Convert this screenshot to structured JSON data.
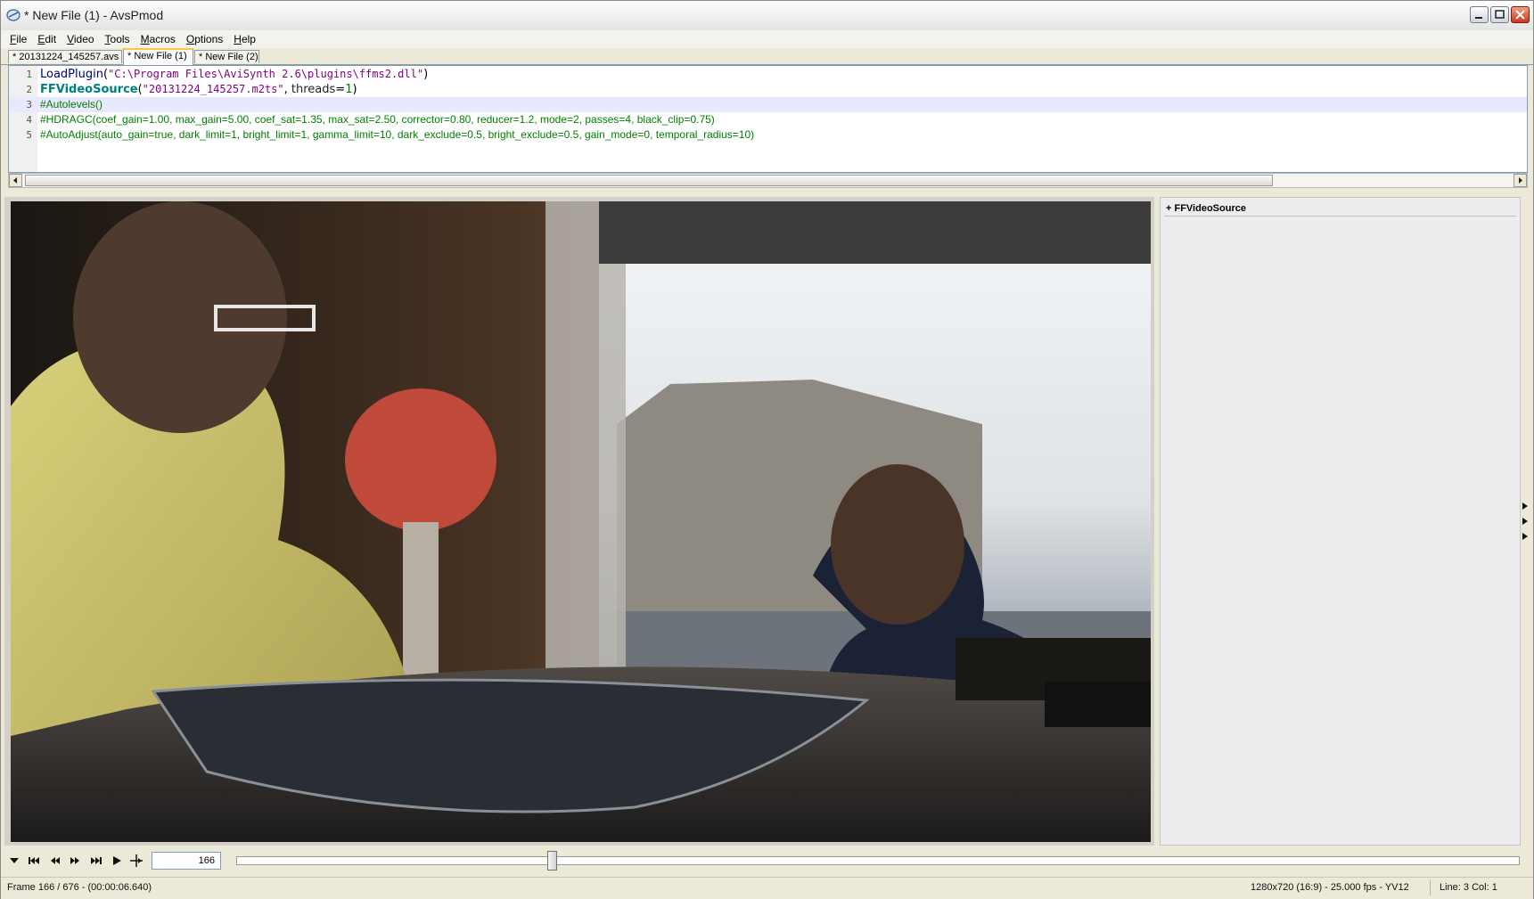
{
  "window": {
    "title": "* New File (1) - AvsPmod"
  },
  "menu": [
    "File",
    "Edit",
    "Video",
    "Tools",
    "Macros",
    "Options",
    "Help"
  ],
  "tabs": [
    "* 20131224_145257.avs",
    "* New File (1)",
    "* New File (2)"
  ],
  "editor": {
    "line_numbers": [
      "1",
      "2",
      "3",
      "4",
      "5"
    ],
    "line1": {
      "fn": "LoadPlugin",
      "open": "(",
      "arg": "\"C:\\Program Files\\AviSynth 2.6\\plugins\\ffms2.dll\"",
      "close": ")"
    },
    "line2": {
      "fn": "FFVideoSource",
      "open": "(",
      "arg": "\"20131224_145257.m2ts\"",
      "comma": ", ",
      "param": "threads",
      "eq": "=",
      "val": "1",
      "close": ")"
    },
    "line3": "#Autolevels()",
    "line4": "#HDRAGC(coef_gain=1.00, max_gain=5.00, coef_sat=1.35, max_sat=2.50, corrector=0.80, reducer=1.2, mode=2, passes=4, black_clip=0.75)",
    "line5": "#AutoAdjust(auto_gain=true, dark_limit=1, bright_limit=1, gamma_limit=10, dark_exclude=0.5, bright_exclude=0.5, gain_mode=0, temporal_radius=10)"
  },
  "side_panel": {
    "header": "+ FFVideoSource"
  },
  "controls": {
    "frame_value": "166",
    "position_fraction": 0.2456
  },
  "status": {
    "frame": "Frame 166 / 676  -  (00:00:06.640)",
    "video_info": "1280x720 (16:9)  -  25.000 fps  -  YV12",
    "cursor": "Line: 3  Col: 1"
  }
}
